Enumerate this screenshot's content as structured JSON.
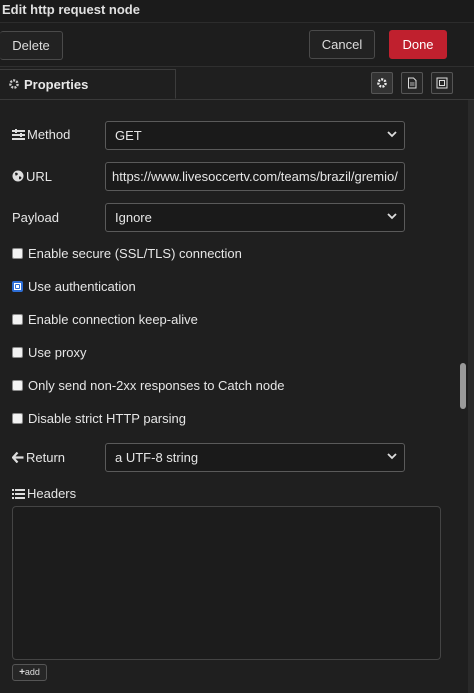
{
  "window": {
    "title": "Edit http request node"
  },
  "toolbar": {
    "delete_label": "Delete",
    "cancel_label": "Cancel",
    "done_label": "Done"
  },
  "tabs": {
    "properties_label": "Properties"
  },
  "icons": {
    "tab_properties": "gear-icon",
    "tab_settings": "gear-icon",
    "tab_description": "document-icon",
    "tab_appearance": "frame-icon",
    "method": "list-icon",
    "url": "globe-icon",
    "return": "arrow-left-icon",
    "headers": "list-icon"
  },
  "form": {
    "method": {
      "label": "Method",
      "value": "GET"
    },
    "url": {
      "label": "URL",
      "value": "https://www.livesoccertv.com/teams/brazil/gremio/"
    },
    "payload": {
      "label": "Payload",
      "value": "Ignore"
    },
    "checks": [
      {
        "label": "Enable secure (SSL/TLS) connection",
        "checked": false
      },
      {
        "label": "Use authentication",
        "checked": false,
        "focused": true
      },
      {
        "label": "Enable connection keep-alive",
        "checked": false
      },
      {
        "label": "Use proxy",
        "checked": false
      },
      {
        "label": "Only send non-2xx responses to Catch node",
        "checked": false
      },
      {
        "label": "Disable strict HTTP parsing",
        "checked": false
      }
    ],
    "return": {
      "label": "Return",
      "value": "a UTF-8 string"
    },
    "headers": {
      "label": "Headers",
      "add_label": "add"
    }
  },
  "colors": {
    "done": "#c0202e",
    "background": "#1f1f1f",
    "focus": "#2d6ed6"
  }
}
